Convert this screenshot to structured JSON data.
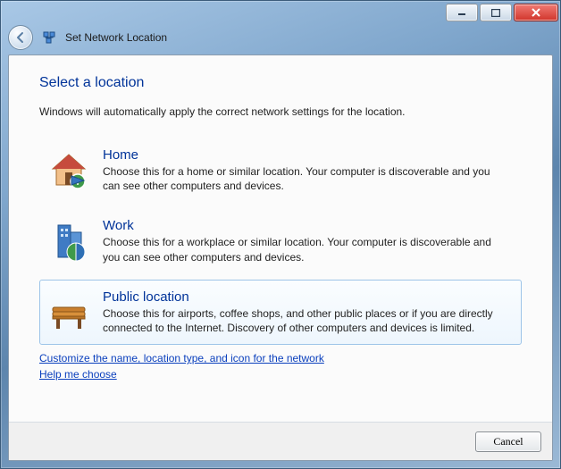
{
  "window": {
    "title": "Set Network Location"
  },
  "heading": "Select a location",
  "intro": "Windows will automatically apply the correct network settings for the location.",
  "options": [
    {
      "title": "Home",
      "desc": "Choose this for a home or similar location. Your computer is discoverable and you can see other computers and devices."
    },
    {
      "title": "Work",
      "desc": "Choose this for a workplace or similar location. Your computer is discoverable and you can see other computers and devices."
    },
    {
      "title": "Public location",
      "desc": "Choose this for airports, coffee shops, and other public places or if you are directly connected to the Internet. Discovery of other computers and devices is limited."
    }
  ],
  "links": {
    "customize": "Customize the name, location type, and icon for the network",
    "help": "Help me choose"
  },
  "footer": {
    "cancel": "Cancel"
  }
}
